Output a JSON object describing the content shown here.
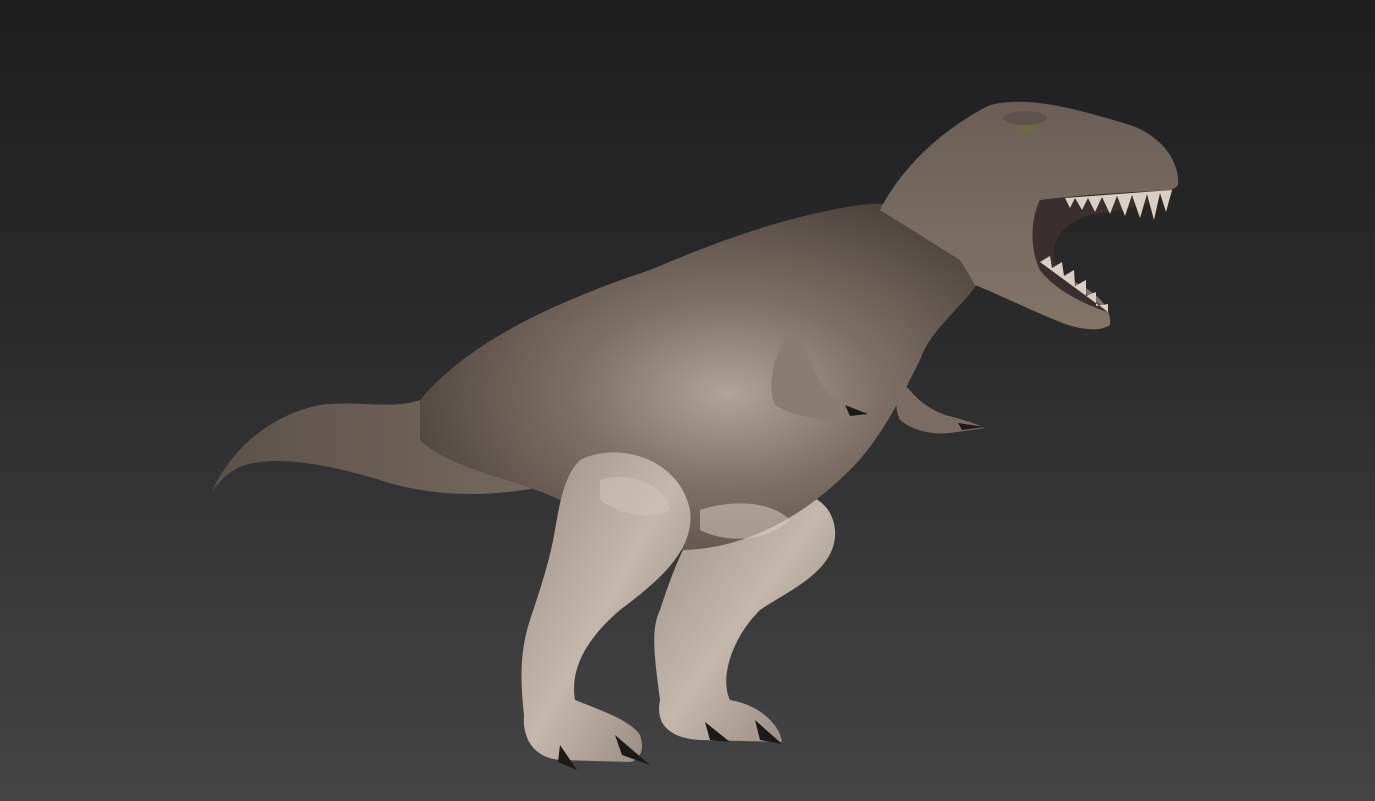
{
  "viewport": {
    "subject": "tyrannosaurus-rex-sculpt",
    "colors": {
      "background_top": "#1e1e1e",
      "background_bottom": "#444444",
      "skin_dark": "#5a4f47",
      "skin_mid": "#7d6f65",
      "skin_light": "#b8aba0",
      "claw": "#1c1a19",
      "teeth": "#d9cfc4",
      "mouth": "#3b2e2e"
    }
  }
}
